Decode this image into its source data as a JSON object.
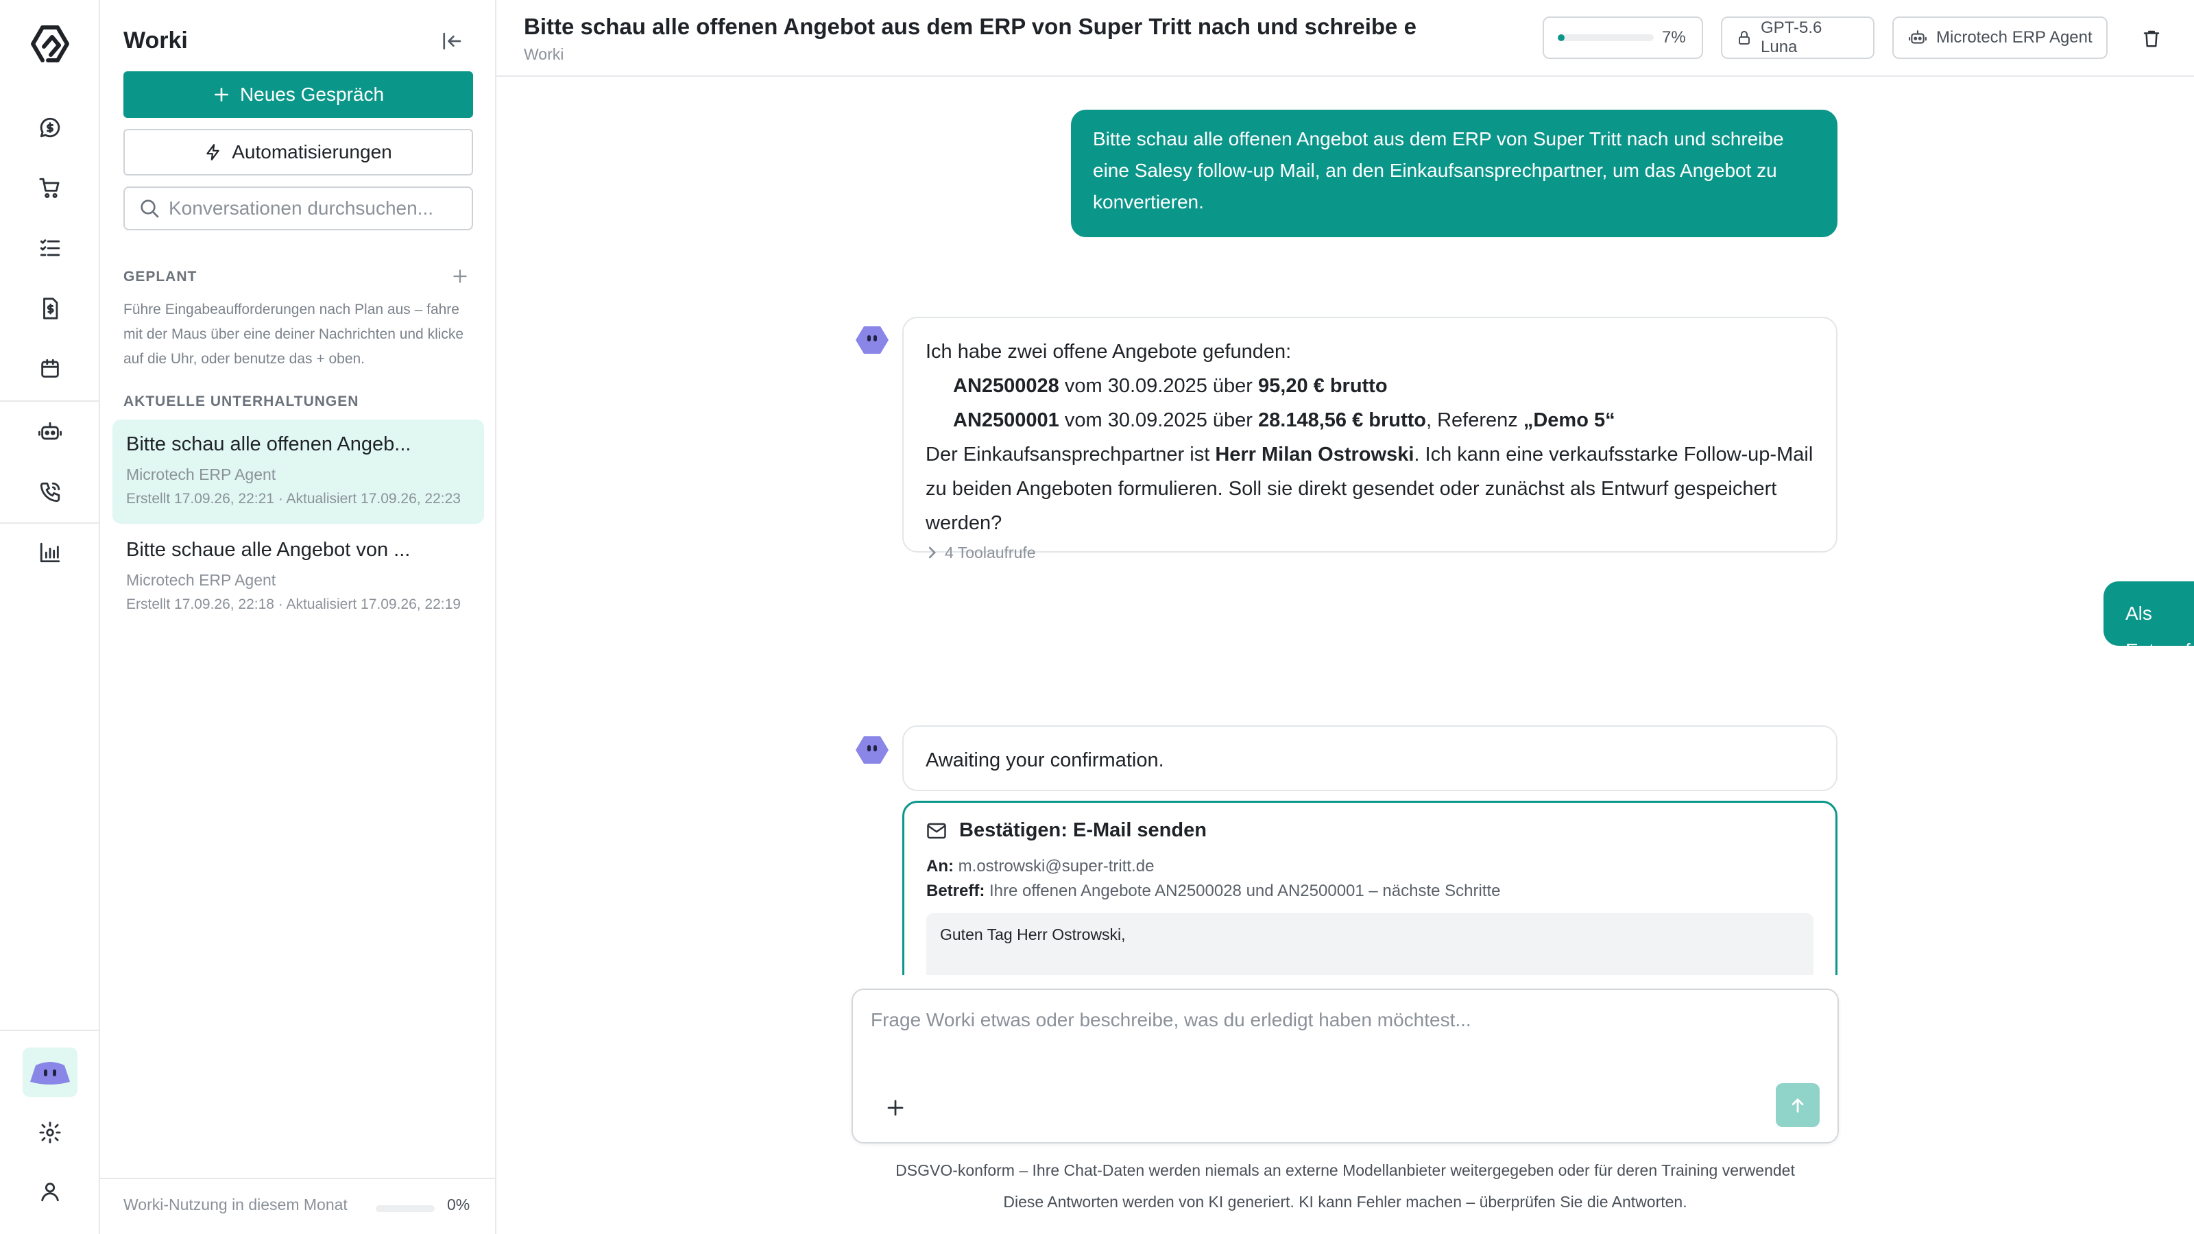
{
  "app": {
    "name": "Worki"
  },
  "colors": {
    "accent": "#0b968a",
    "accent_light": "#e0f7f2",
    "bot_avatar": "#8a86e8"
  },
  "rail": {
    "items": [
      {
        "icon": "chat-icon"
      },
      {
        "icon": "cart-icon"
      },
      {
        "icon": "checklist-icon"
      },
      {
        "icon": "invoice-icon"
      },
      {
        "icon": "calendar-icon"
      },
      {
        "icon": "robot-icon"
      },
      {
        "icon": "phone-icon"
      },
      {
        "icon": "bar-chart-icon"
      }
    ],
    "bottom": [
      {
        "icon": "bot-avatar-icon"
      },
      {
        "icon": "gear-icon"
      },
      {
        "icon": "user-icon"
      }
    ]
  },
  "sidebar": {
    "title": "Worki",
    "new_chat_label": "Neues Gespräch",
    "automations_label": "Automatisierungen",
    "search_placeholder": "Konversationen durchsuchen...",
    "scheduled_label": "GEPLANT",
    "scheduled_description": "Führe Eingabeaufforderungen nach Plan aus – fahre mit der Maus über eine deiner Nachrichten und klicke auf die Uhr, oder benutze das + oben.",
    "recent_label": "AKTUELLE UNTERHALTUNGEN",
    "conversations": [
      {
        "title": "Bitte schau alle offenen Angeb...",
        "agent": "Microtech ERP Agent",
        "meta": "Erstellt 17.09.26, 22:21 · Aktualisiert 17.09.26, 22:23"
      },
      {
        "title": "Bitte schaue alle Angebot von ...",
        "agent": "Microtech ERP Agent",
        "meta": "Erstellt 17.09.26, 22:18 · Aktualisiert 17.09.26, 22:19"
      }
    ],
    "usage_label": "Worki-Nutzung in diesem Monat",
    "usage_percent_text": "0%",
    "usage_fraction": 0.0
  },
  "header": {
    "title": "Bitte schau alle offenen Angebot aus dem ERP von Super Tritt nach und schreibe e",
    "subtitle": "Worki",
    "progress_text": "7%",
    "progress_fraction": 0.07,
    "model_label": "GPT-5.6 Luna",
    "agent_label": "Microtech ERP Agent"
  },
  "chat": {
    "user_message_1": "Bitte schau alle offenen Angebot aus dem ERP von Super Tritt nach und schreibe eine Salesy follow-up Mail, an den Einkaufsansprechpartner, um das Angebot zu konvertieren.",
    "bot_message_1": {
      "intro": "Ich habe zwei offene Angebote gefunden:",
      "offers": [
        {
          "id": "AN2500028",
          "date_text": " vom 30.09.2025 über ",
          "amount": "95,20 € brutto",
          "ref_prefix": "",
          "ref": ""
        },
        {
          "id": "AN2500001",
          "date_text": " vom 30.09.2025 über ",
          "amount": "28.148,56 € brutto",
          "ref_prefix": ", Referenz ",
          "ref": "„Demo 5“"
        }
      ],
      "contact_prefix": "Der Einkaufsansprechpartner ist ",
      "contact_name": "Herr Milan Ostrowski",
      "contact_suffix": ". Ich kann eine verkaufsstarke Follow-up-Mail zu beiden Angeboten formulieren. Soll sie direkt gesendet oder zunächst als Entwurf gespeichert werden?",
      "tool_calls": "4 Toolaufrufe"
    },
    "user_message_2": "Als Entwurf speichern",
    "bot_message_2": "Awaiting your confirmation.",
    "confirm": {
      "title": "Bestätigen: E-Mail senden",
      "to_label": "An:",
      "to_value": "m.ostrowski@super-tritt.de",
      "subject_label": "Betreff:",
      "subject_value": "Ihre offenen Angebote AN2500028 und AN2500001 – nächste Schritte",
      "body_preview": "Guten Tag Herr Ostrowski,"
    }
  },
  "composer": {
    "placeholder": "Frage Worki etwas oder beschreibe, was du erledigt haben möchtest..."
  },
  "footer": {
    "line1": "DSGVO-konform – Ihre Chat-Daten werden niemals an externe Modellanbieter weitergegeben oder für deren Training verwendet",
    "line2": "Diese Antworten werden von KI generiert. KI kann Fehler machen – überprüfen Sie die Antworten."
  }
}
